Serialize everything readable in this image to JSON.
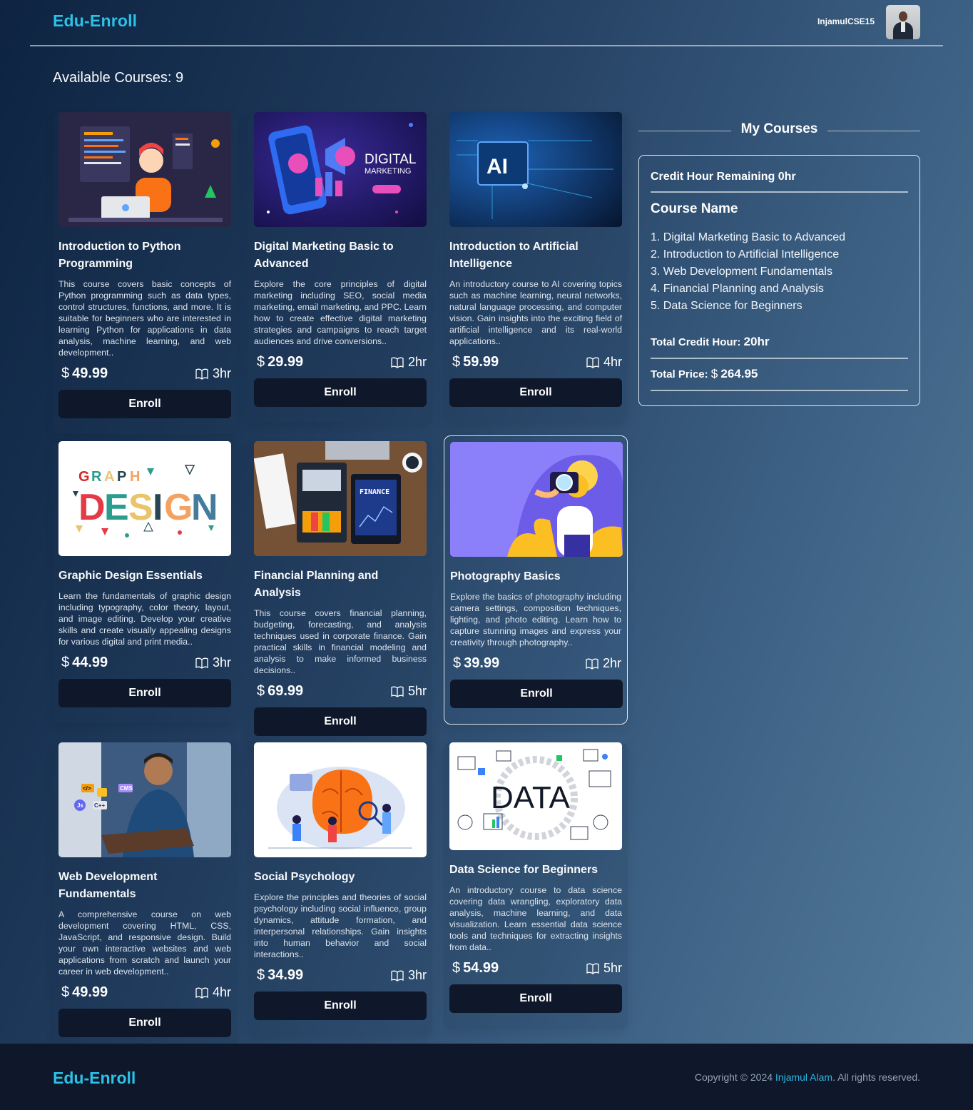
{
  "header": {
    "brand": "Edu-Enroll",
    "username": "InjamulCSE15"
  },
  "main": {
    "available_label": "Available Courses: 9"
  },
  "courses": [
    {
      "title": "Introduction to Python Programming",
      "description": "This course covers basic concepts of Python programming such as data types, control structures, functions, and more. It is suitable for beginners who are interested in learning Python for applications in data analysis, machine learning, and web development..",
      "currency": "$",
      "price": "49.99",
      "hours": "3hr",
      "button": "Enroll",
      "image": "web-developing-illustration"
    },
    {
      "title": "Digital Marketing Basic to Advanced",
      "description": "Explore the core principles of digital marketing including SEO, social media marketing, email marketing, and PPC. Learn how to create effective digital marketing strategies and campaigns to reach target audiences and drive conversions..",
      "currency": "$",
      "price": "29.99",
      "hours": "2hr",
      "button": "Enroll",
      "image": "digital-marketing-illustration",
      "image_text": [
        "DIGITAL",
        "MARKETING"
      ]
    },
    {
      "title": "Introduction to Artificial Intelligence",
      "description": "An introductory course to AI covering topics such as machine learning, neural networks, natural language processing, and computer vision. Gain insights into the exciting field of artificial intelligence and its real-world applications..",
      "currency": "$",
      "price": "59.99",
      "hours": "4hr",
      "button": "Enroll",
      "image": "ai-chip-illustration",
      "image_text": "AI"
    },
    {
      "title": "Graphic Design Essentials",
      "description": "Learn the fundamentals of graphic design including typography, color theory, layout, and image editing. Develop your creative skills and create visually appealing designs for various digital and print media..",
      "currency": "$",
      "price": "44.99",
      "hours": "3hr",
      "button": "Enroll",
      "image": "graphic-design-typography"
    },
    {
      "title": "Financial Planning and Analysis",
      "description": "This course covers financial planning, budgeting, forecasting, and analysis techniques used in corporate finance. Gain practical skills in financial modeling and analysis to make informed business decisions..",
      "currency": "$",
      "price": "69.99",
      "hours": "5hr",
      "button": "Enroll",
      "image": "finance-desk-photo"
    },
    {
      "title": "Photography Basics",
      "description": "Explore the basics of photography including camera settings, composition techniques, lighting, and photo editing. Learn how to capture stunning images and express your creativity through photography..",
      "currency": "$",
      "price": "39.99",
      "hours": "2hr",
      "button": "Enroll",
      "image": "photographer-illustration"
    },
    {
      "title": "Web Development Fundamentals",
      "description": "A comprehensive course on web development covering HTML, CSS, JavaScript, and responsive design. Build your own interactive websites and web applications from scratch and launch your career in web development..",
      "currency": "$",
      "price": "49.99",
      "hours": "4hr",
      "button": "Enroll",
      "image": "web-developer-photo"
    },
    {
      "title": "Social Psychology",
      "description": "Explore the principles and theories of social psychology including social influence, group dynamics, attitude formation, and interpersonal relationships. Gain insights into human behavior and social interactions..",
      "currency": "$",
      "price": "34.99",
      "hours": "3hr",
      "button": "Enroll",
      "image": "psychology-brain-illustration"
    },
    {
      "title": "Data Science for Beginners",
      "description": "An introductory course to data science covering data wrangling, exploratory data analysis, machine learning, and data visualization. Learn essential data science tools and techniques for extracting insights from data..",
      "currency": "$",
      "price": "54.99",
      "hours": "5hr",
      "button": "Enroll",
      "image": "data-science-illustration",
      "image_text": "DATA"
    }
  ],
  "sidebar": {
    "title": "My Courses",
    "credit_remaining_label": "Credit Hour Remaining",
    "credit_remaining_value": "0hr",
    "course_name_label": "Course Name",
    "selected": [
      "1. Digital Marketing Basic to Advanced",
      "2. Introduction to Artificial Intelligence",
      "3. Web Development Fundamentals",
      "4. Financial Planning and Analysis",
      "5. Data Science for Beginners"
    ],
    "total_credit_label": "Total Credit Hour:",
    "total_credit_value": "20hr",
    "total_price_label": "Total Price:",
    "total_price_currency": "$",
    "total_price_value": "264.95"
  },
  "footer": {
    "brand": "Edu-Enroll",
    "copyright_prefix": "Copyright © 2024",
    "author": "Injamul Alam",
    "copyright_suffix": ". All rights reserved."
  },
  "colors": {
    "brand": "#2bc2e8",
    "button": "#0f172a",
    "footer_bg": "#0f172a"
  }
}
